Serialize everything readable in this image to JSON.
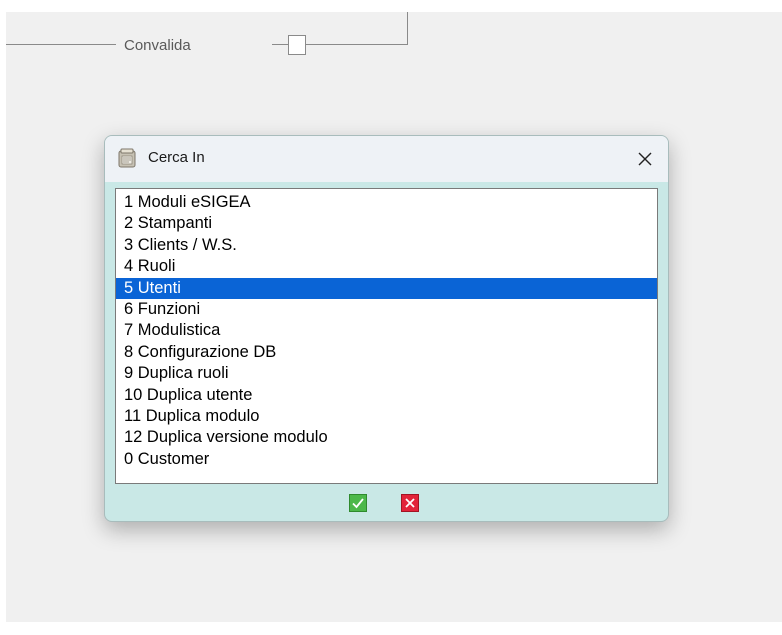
{
  "background": {
    "flow_label": "Convalida"
  },
  "dialog": {
    "title": "Cerca In",
    "icon": "app-window-icon",
    "close_icon": "close-icon",
    "items": [
      {
        "label": "1 Moduli eSIGEA",
        "selected": false
      },
      {
        "label": "2 Stampanti",
        "selected": false
      },
      {
        "label": "3 Clients / W.S.",
        "selected": false
      },
      {
        "label": "4 Ruoli",
        "selected": false
      },
      {
        "label": "5 Utenti",
        "selected": true
      },
      {
        "label": "6 Funzioni",
        "selected": false
      },
      {
        "label": "7 Modulistica",
        "selected": false
      },
      {
        "label": "8 Configurazione DB",
        "selected": false
      },
      {
        "label": "9 Duplica ruoli",
        "selected": false
      },
      {
        "label": "10 Duplica utente",
        "selected": false
      },
      {
        "label": "11 Duplica modulo",
        "selected": false
      },
      {
        "label": "12 Duplica versione modulo",
        "selected": false
      },
      {
        "label": "0 Customer",
        "selected": false
      }
    ],
    "ok_icon": "checkmark-icon",
    "cancel_icon": "x-icon"
  },
  "colors": {
    "dialog_bg": "#c9e8e6",
    "titlebar_bg": "#eef2f6",
    "selection": "#0a64d6",
    "ok_green": "#4cb84a",
    "cancel_red": "#e2243a"
  }
}
